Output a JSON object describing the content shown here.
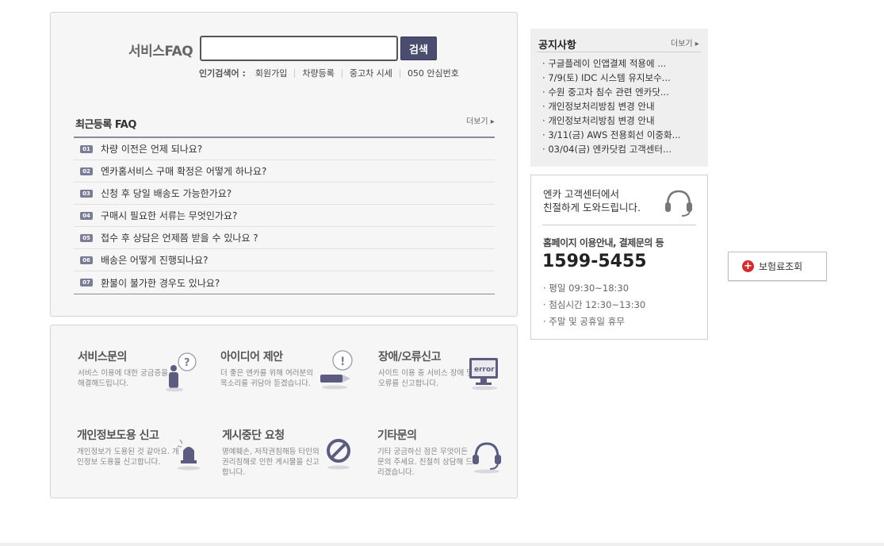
{
  "faq_search": {
    "title": "서비스FAQ",
    "input_value": "",
    "search_button": "검색",
    "popular_label": "인기검색어",
    "popular_sep": ":",
    "keywords": [
      "회원가입",
      "차량등록",
      "중고차 시세",
      "050 안심번호"
    ]
  },
  "recent_faq": {
    "title": "최근등록 FAQ",
    "more": "더보기 ▸",
    "items": [
      {
        "num": "01",
        "text": "차량 이전은 언제 되나요?"
      },
      {
        "num": "02",
        "text": "엔카홈서비스 구매 확정은 어떻게 하나요?"
      },
      {
        "num": "03",
        "text": "신청 후 당일 배송도 가능한가요?"
      },
      {
        "num": "04",
        "text": "구매시 필요한 서류는 무엇인가요?"
      },
      {
        "num": "05",
        "text": "접수 후 상담은 언제쯤 받을 수 있나요 ?"
      },
      {
        "num": "06",
        "text": "배송은 어떻게 진행되나요?"
      },
      {
        "num": "07",
        "text": "환불이 불가한 경우도 있나요?"
      }
    ]
  },
  "categories": [
    {
      "title": "서비스문의",
      "desc": "서비스 이용에 대한 궁금증을 해결해드립니다.",
      "icon": "person-question-icon"
    },
    {
      "title": "아이디어 제안",
      "desc": "더 좋은 엔카를 위해 여러분의 목소리를 귀담아 듣겠습니다.",
      "icon": "pencil-exclamation-icon"
    },
    {
      "title": "장애/오류신고",
      "desc": "사이트 이용 중 서비스 장애 및 오류를 신고합니다.",
      "icon": "monitor-error-icon",
      "icon_text": "error"
    },
    {
      "title": "개인정보도용 신고",
      "desc": "개인정보가 도용된 것 같아요. 개인정보 도용을 신고합니다.",
      "icon": "alarm-siren-icon"
    },
    {
      "title": "게시중단 요청",
      "desc": "명예훼손, 저작권침해등 타인의 권리침해로 인한 게시물을 신고합니다.",
      "icon": "prohibited-icon"
    },
    {
      "title": "기타문의",
      "desc": "기타 궁금하신 점은 무엇이든 문의 주세요. 친절히 상담해 드리겠습니다.",
      "icon": "headset-icon"
    }
  ],
  "notice": {
    "title": "공지사항",
    "more": "더보기 ▸",
    "items": [
      "구글플레이 인앱결제 적용에 ...",
      "7/9(토) IDC 시스템 유지보수...",
      "수원 중고차 침수 관련 엔카닷...",
      "개인정보처리방침 변경 안내",
      "개인정보처리방침 변경 안내",
      "3/11(금) AWS 전용회선 이중화...",
      "03/04(금) 엔카닷컴 고객센터..."
    ]
  },
  "customer_center": {
    "intro_line1": "엔카 고객센터에서",
    "intro_line2": "친절하게 도와드립니다.",
    "subtitle": "홈페이지 이용안내, 결제문의 등",
    "phone": "1599-5455",
    "hours": [
      "· 평일 09:30~18:30",
      "· 점심시간 12:30~13:30",
      "· 주말 및 공휴일 휴무"
    ]
  },
  "insurance_button": {
    "label": "보험료조회",
    "icon": "plus-circle-icon"
  },
  "colors": {
    "accent": "#4a4c70",
    "badge": "#7b7c95",
    "panel_bg": "#f6f6f7",
    "plus_red": "#d42b2b"
  }
}
